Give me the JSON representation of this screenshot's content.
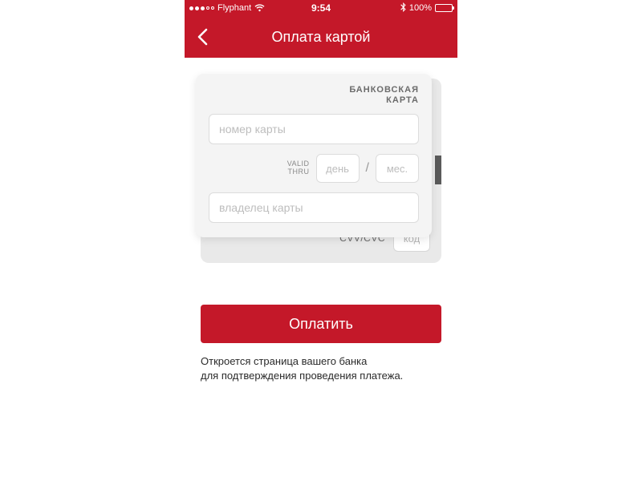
{
  "status": {
    "carrier": "Flyphant",
    "time": "9:54",
    "battery_pct": "100%"
  },
  "nav": {
    "title": "Оплата картой"
  },
  "card": {
    "label_line1": "БАНКОВСКАЯ",
    "label_line2": "КАРТА",
    "number_placeholder": "номер карты",
    "valid_line1": "VALID",
    "valid_line2": "THRU",
    "day_placeholder": "день",
    "month_placeholder": "мес.",
    "slash": "/",
    "holder_placeholder": "владелец карты",
    "cvv_label": "CVV/CVC",
    "cvv_placeholder": "код"
  },
  "actions": {
    "pay_label": "Оплатить"
  },
  "hint": {
    "line1": "Откроется страница вашего банка",
    "line2": "для подтверждения проведения платежа."
  }
}
